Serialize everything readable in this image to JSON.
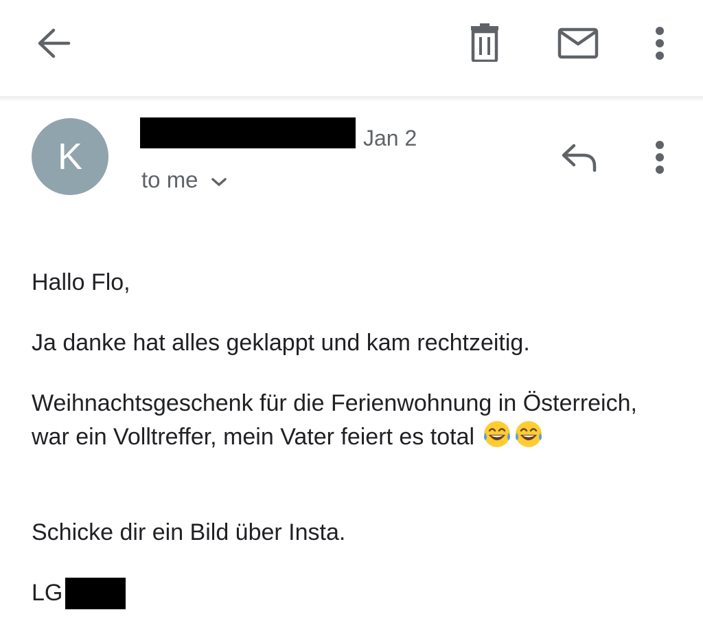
{
  "toolbar": {
    "back_icon": "arrow-back-icon",
    "delete_icon": "trash-icon",
    "mark_unread_icon": "mail-icon",
    "more_icon": "more-vert-icon"
  },
  "message": {
    "avatar_letter": "K",
    "avatar_color": "#90a4ae",
    "date": "Jan 2",
    "recipient": "to me",
    "reply_icon": "reply-icon",
    "more_icon": "more-vert-icon"
  },
  "body": {
    "greeting": "Hallo Flo,",
    "line1": "Ja danke hat alles geklappt und kam rechtzeitig.",
    "line2": "Weihnachtsgeschenk für die Ferienwohnung in Österreich, war ein Volltreffer, mein Vater feiert es total",
    "emoji": "😂😂",
    "line3": "Schicke dir ein Bild über Insta.",
    "signoff": "LG"
  },
  "colors": {
    "icon_gray": "#5f6368",
    "redaction": "#000000"
  }
}
